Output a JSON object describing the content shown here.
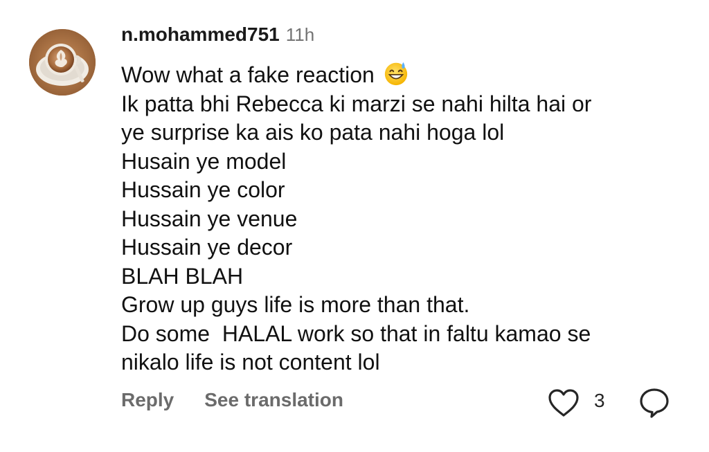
{
  "comment": {
    "username": "n.mohammed751",
    "timestamp": "11h",
    "avatar_icon": "latte-art-coffee-cup-avatar",
    "lines": [
      "Wow what a fake reaction",
      "Ik patta bhi Rebecca ki marzi se nahi hilta hai or",
      "ye surprise ka ais ko pata nahi hoga lol",
      "Husain ye model",
      "Hussain ye color",
      "Hussain ye venue",
      "Hussain ye decor",
      "BLAH BLAH",
      "Grow up guys life is more than that.",
      "Do some  HALAL work so that in faltu kamao se",
      "nikalo life is not content lol"
    ],
    "emoji": "grinning-face-with-sweat-emoji"
  },
  "actions": {
    "reply_label": "Reply",
    "translate_label": "See translation",
    "like_count": "3",
    "like_icon": "heart-outline-icon",
    "reply_icon": "speech-bubble-icon"
  },
  "colors": {
    "username": "#1a1a1a",
    "timestamp": "#737373",
    "action_text": "#6b6b6b",
    "body_text": "#111111"
  }
}
